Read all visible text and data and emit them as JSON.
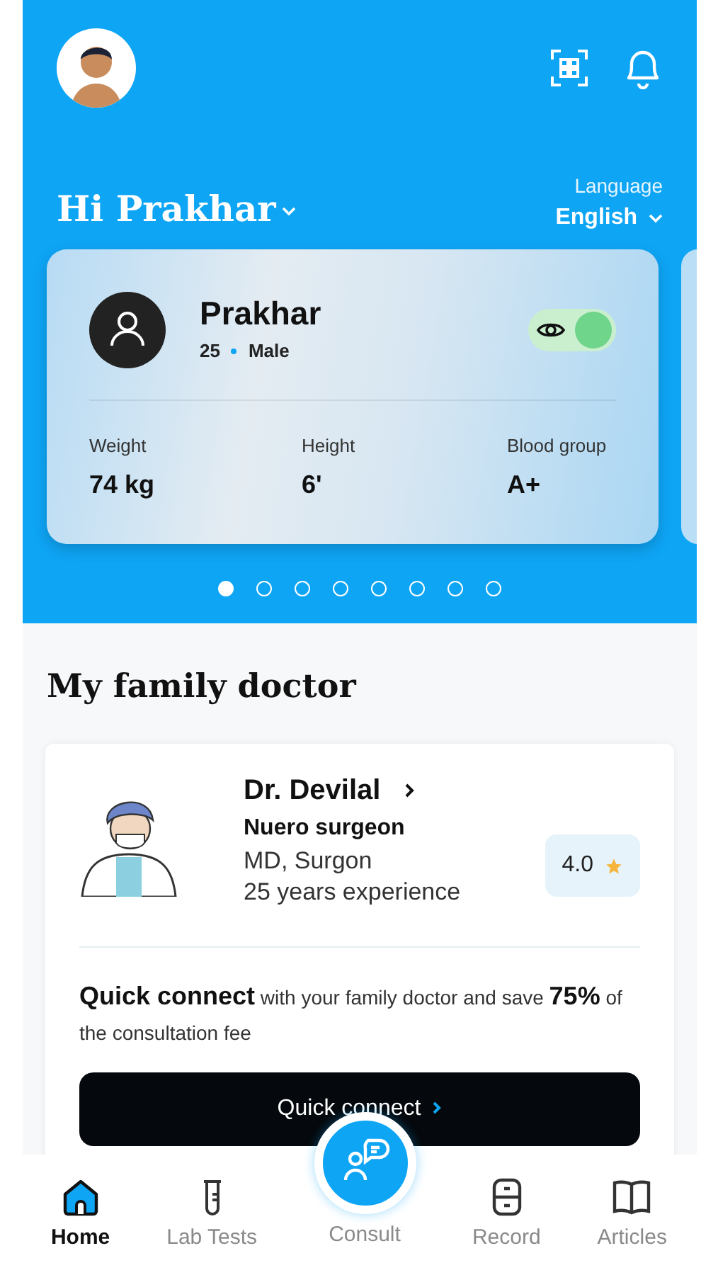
{
  "header": {
    "greeting": "Hi Prakhar",
    "language_label": "Language",
    "language": "English"
  },
  "profile_card": {
    "name": "Prakhar",
    "age": "25",
    "gender": "Male",
    "visible": true,
    "stats": [
      {
        "label": "Weight",
        "value": "74 kg"
      },
      {
        "label": "Height",
        "value": "6'"
      },
      {
        "label": "Blood group",
        "value": "A+"
      }
    ]
  },
  "carousel_dots": [
    {
      "selected": true
    },
    {
      "selected": false
    },
    {
      "selected": false
    },
    {
      "selected": false
    },
    {
      "selected": false
    },
    {
      "selected": false
    },
    {
      "selected": false
    },
    {
      "selected": false
    }
  ],
  "section_title": "My family doctor",
  "doctor": {
    "name": "Dr. Devilal",
    "specialty": "Nuero surgeon",
    "degree": "MD, Surgon",
    "experience": "25 years experience",
    "rating": "4.0"
  },
  "quick_connect": {
    "text": "**Quick connect** with your family doctor and save **75%** of the consultation fee",
    "button": "Quick connect"
  },
  "nav": [
    {
      "label": "Home",
      "kind": "home",
      "selected": true
    },
    {
      "label": "Lab Tests",
      "kind": "lab",
      "selected": false
    },
    {
      "label": "Consult",
      "kind": "consult",
      "selected": false
    },
    {
      "label": "Record",
      "kind": "record",
      "selected": false
    },
    {
      "label": "Articles",
      "kind": "articles",
      "selected": false
    }
  ]
}
